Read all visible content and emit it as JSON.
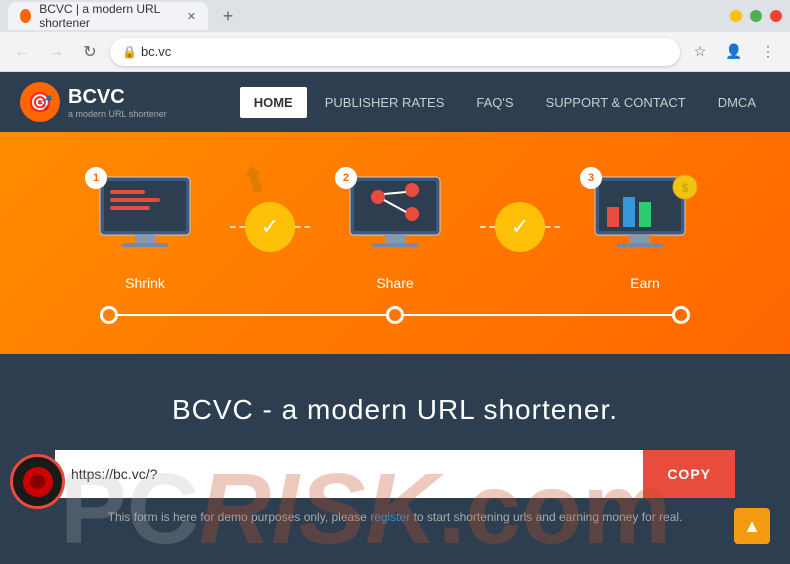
{
  "browser": {
    "tab_title": "BCVC | a modern URL shortener",
    "tab_add_label": "+",
    "address": "bc.vc",
    "nav": {
      "back_label": "←",
      "forward_label": "→",
      "refresh_label": "↻",
      "star_label": "☆",
      "account_label": "👤",
      "more_label": "⋮"
    }
  },
  "site": {
    "logo_text": "BCVC",
    "logo_subtitle": "a modern URL shortener",
    "logo_emoji": "🎯",
    "nav_links": [
      {
        "label": "HOME",
        "active": true
      },
      {
        "label": "PUBLISHER RATES",
        "active": false
      },
      {
        "label": "FAQ'S",
        "active": false
      },
      {
        "label": "SUPPORT & CONTACT",
        "active": false
      },
      {
        "label": "DMCA",
        "active": false
      }
    ],
    "hero": {
      "steps": [
        {
          "number": "1",
          "label": "Shrink"
        },
        {
          "number": "2",
          "label": "Share"
        },
        {
          "number": "3",
          "label": "Earn"
        }
      ]
    },
    "dark_section": {
      "heading": "BCVC - a modern URL shortener.",
      "url_placeholder": "https://bc.vc/?",
      "copy_button": "COPY",
      "note": "This form is here for demo purposes only, please",
      "note_link": "register",
      "note_suffix": "to start shortening urls and earning money for real."
    },
    "scroll_up_label": "▲"
  },
  "watermark": {
    "pc": "PC",
    "risk": "RISK",
    "com": ".com"
  }
}
